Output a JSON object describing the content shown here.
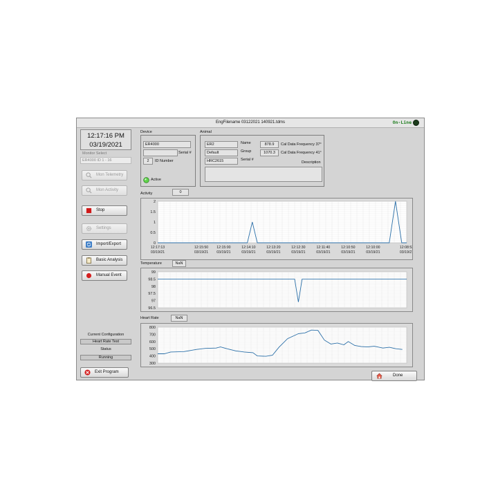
{
  "window_title": "EngFilename 03122021 140921.tdms",
  "online_label": "On-Line",
  "clock": {
    "time": "12:17:16 PM",
    "date": "03/19/2021"
  },
  "monitor_select": {
    "label": "Monitor Select",
    "value": "ER4000 ID 1 - 16"
  },
  "buttons": {
    "mon_telemetry": "Mon Telemetry",
    "mon_activity": "Mon Activity",
    "stop": "Stop",
    "settings": "Settings",
    "import_export": "Import/Export",
    "basic_analysis": "Basic Analysis",
    "manual_event": "Manual Event",
    "exit_program": "Exit Program",
    "done": "Done"
  },
  "current_configuration": {
    "label": "Current Configuration",
    "value": "Heart Rate Test"
  },
  "status": {
    "label": "Status",
    "value": "Running"
  },
  "device": {
    "title": "Device",
    "model": "ER4000",
    "serial_value": "",
    "serial_label": "Serial #",
    "id_value": "2",
    "id_label": "ID Number",
    "active_label": "Active"
  },
  "animal": {
    "title": "Animal",
    "name_value": "ER2",
    "name_label": "Name",
    "group_value": "Default",
    "group_label": "Group",
    "serial_value": "HRC2615",
    "serial_label": "Serial #",
    "cal37_value": "878.9",
    "cal37_label": "Cal Data Frequency 37°",
    "cal41_value": "1070.3",
    "cal41_label": "Cal Data Frequency 41°",
    "description_label": "Description",
    "description_value": ""
  },
  "activity": {
    "label": "Activity",
    "value": "0"
  },
  "temperature": {
    "label": "Temperature",
    "value": "NaN"
  },
  "heart_rate": {
    "label": "Heart Rate",
    "value": "NaN"
  },
  "colors": {
    "line": "#2a6fa8",
    "grid": "#e3e3e3",
    "plot_bg": "#ffffff",
    "panel": "#d4d4d4"
  },
  "chart_data": [
    {
      "type": "line",
      "name": "activity",
      "ylim": [
        0,
        2
      ],
      "yticks": [
        "0",
        "0.5",
        "1",
        "1.5",
        "2"
      ],
      "x_ticks": [
        {
          "time": "12:17:13",
          "date": "03/19/21"
        },
        {
          "time": "12:15:50",
          "date": "03/19/21"
        },
        {
          "time": "12:15:00",
          "date": "03/19/21"
        },
        {
          "time": "12:14:10",
          "date": "03/19/21"
        },
        {
          "time": "12:13:20",
          "date": "03/19/21"
        },
        {
          "time": "12:12:30",
          "date": "03/19/21"
        },
        {
          "time": "12:11:40",
          "date": "03/19/21"
        },
        {
          "time": "12:10:50",
          "date": "03/19/21"
        },
        {
          "time": "12:10:00",
          "date": "03/19/21"
        },
        {
          "time": "12:08:53",
          "date": "03/19/21"
        }
      ],
      "points": [
        [
          0,
          0
        ],
        [
          0.36,
          0
        ],
        [
          0.38,
          1
        ],
        [
          0.4,
          0
        ],
        [
          0.93,
          0
        ],
        [
          0.955,
          2
        ],
        [
          0.98,
          0
        ],
        [
          1,
          0
        ]
      ]
    },
    {
      "type": "line",
      "name": "temperature",
      "ylim": [
        96.5,
        99
      ],
      "yticks": [
        "96.5",
        "97",
        "97.5",
        "98",
        "98.5",
        "99"
      ],
      "points": [
        [
          0,
          98.5
        ],
        [
          0.55,
          98.5
        ],
        [
          0.565,
          96.9
        ],
        [
          0.58,
          98.5
        ],
        [
          1,
          98.5
        ]
      ]
    },
    {
      "type": "line",
      "name": "heart_rate",
      "ylim": [
        300,
        800
      ],
      "yticks": [
        "300",
        "400",
        "500",
        "600",
        "700",
        "800"
      ],
      "points": [
        [
          0,
          430
        ],
        [
          0.03,
          430
        ],
        [
          0.06,
          455
        ],
        [
          0.12,
          460
        ],
        [
          0.18,
          490
        ],
        [
          0.22,
          505
        ],
        [
          0.27,
          510
        ],
        [
          0.29,
          525
        ],
        [
          0.32,
          500
        ],
        [
          0.36,
          470
        ],
        [
          0.4,
          455
        ],
        [
          0.44,
          445
        ],
        [
          0.46,
          400
        ],
        [
          0.5,
          395
        ],
        [
          0.53,
          410
        ],
        [
          0.56,
          520
        ],
        [
          0.6,
          640
        ],
        [
          0.65,
          710
        ],
        [
          0.68,
          720
        ],
        [
          0.71,
          760
        ],
        [
          0.74,
          755
        ],
        [
          0.77,
          620
        ],
        [
          0.8,
          565
        ],
        [
          0.83,
          580
        ],
        [
          0.86,
          555
        ],
        [
          0.88,
          600
        ],
        [
          0.91,
          545
        ],
        [
          0.94,
          530
        ],
        [
          0.97,
          525
        ],
        [
          1.0,
          535
        ],
        [
          1.04,
          510
        ],
        [
          1.07,
          520
        ],
        [
          1.1,
          500
        ],
        [
          1.13,
          490
        ]
      ]
    }
  ]
}
